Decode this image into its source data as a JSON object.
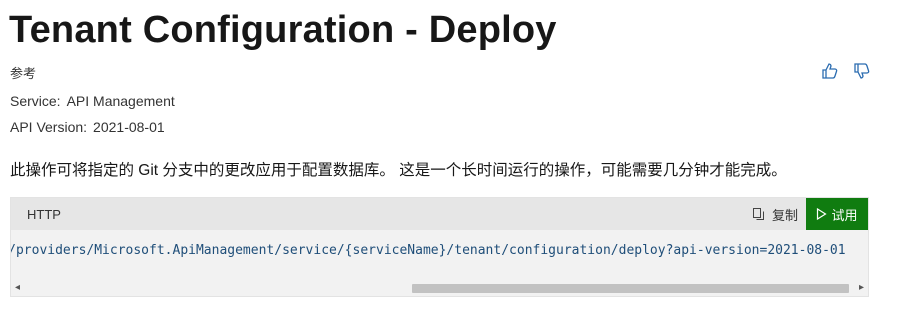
{
  "page": {
    "title": "Tenant Configuration - Deploy",
    "meta_label": "参考",
    "service_label": "Service:",
    "service_value": "API Management",
    "api_version_label": "API Version:",
    "api_version_value": "2021-08-01",
    "description": "此操作可将指定的 Git 分支中的更改应用于配置数据库。 这是一个长时间运行的操作，可能需要几分钟才能完成。"
  },
  "feedback": {
    "like_icon": "thumbs-up-icon",
    "dislike_icon": "thumbs-down-icon"
  },
  "code_block": {
    "language": "HTTP",
    "copy_label": "复制",
    "try_label": "试用",
    "code": "Name}/providers/Microsoft.ApiManagement/service/{serviceName}/tenant/configuration/deploy?api-version=2021-08-01",
    "scroll_fraction": 0.5
  },
  "colors": {
    "try_button": "#107c10",
    "code_text": "#1f4e79"
  }
}
